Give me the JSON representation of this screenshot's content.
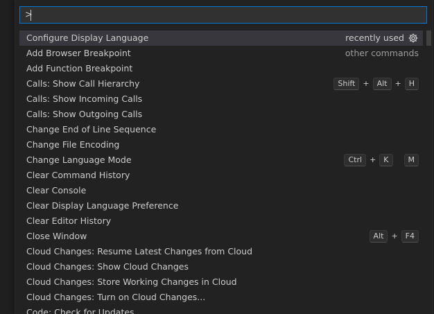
{
  "input": {
    "value": ">"
  },
  "selected": {
    "label": "Configure Display Language",
    "hint": "recently used",
    "icon": "gear-icon"
  },
  "items": [
    {
      "label": "Add Browser Breakpoint",
      "hint": "other commands"
    },
    {
      "label": "Add Function Breakpoint"
    },
    {
      "label": "Calls: Show Call Hierarchy",
      "keys": [
        "Shift",
        "Alt",
        "H"
      ]
    },
    {
      "label": "Calls: Show Incoming Calls"
    },
    {
      "label": "Calls: Show Outgoing Calls"
    },
    {
      "label": "Change End of Line Sequence"
    },
    {
      "label": "Change File Encoding"
    },
    {
      "label": "Change Language Mode",
      "keys": [
        "Ctrl",
        "K"
      ],
      "keys2": [
        "M"
      ]
    },
    {
      "label": "Clear Command History"
    },
    {
      "label": "Clear Console"
    },
    {
      "label": "Clear Display Language Preference"
    },
    {
      "label": "Clear Editor History"
    },
    {
      "label": "Close Window",
      "keys": [
        "Alt",
        "F4"
      ]
    },
    {
      "label": "Cloud Changes: Resume Latest Changes from Cloud"
    },
    {
      "label": "Cloud Changes: Show Cloud Changes"
    },
    {
      "label": "Cloud Changes: Store Working Changes in Cloud"
    },
    {
      "label": "Cloud Changes: Turn on Cloud Changes..."
    },
    {
      "label": "Code: Check for Updates"
    }
  ],
  "colors": {
    "accent": "#0078d4",
    "selection": "#37373d"
  }
}
